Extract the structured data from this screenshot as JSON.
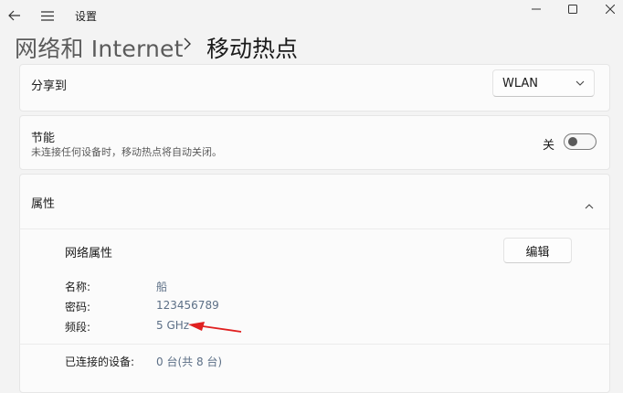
{
  "window": {
    "app_title": "设置",
    "icons": {
      "back": "back-arrow-icon",
      "menu": "hamburger-menu-icon"
    },
    "controls": {
      "minimize": "minimize-icon",
      "maximize": "maximize-icon",
      "close": "close-icon"
    }
  },
  "breadcrumb": {
    "parent": "网络和 Internet",
    "separator_icon": "chevron-right-icon",
    "current": "移动热点"
  },
  "share": {
    "label": "分享到",
    "selected": "WLAN",
    "icon": "chevron-down-icon"
  },
  "power_saving": {
    "label": "节能",
    "description": "未连接任何设备时，移动热点将自动关闭。",
    "state_label": "关",
    "toggle_on": false
  },
  "properties": {
    "header": "属性",
    "collapse_icon": "chevron-up-icon",
    "network_title": "网络属性",
    "edit_label": "编辑",
    "items": [
      {
        "key": "名称:",
        "value": "船"
      },
      {
        "key": "密码:",
        "value": "123456789"
      },
      {
        "key": "频段:",
        "value": "5 GHz"
      }
    ],
    "devices_label": "已连接的设备:",
    "devices_value": "0 台(共 8 台)",
    "annotation_color": "#e02020"
  }
}
